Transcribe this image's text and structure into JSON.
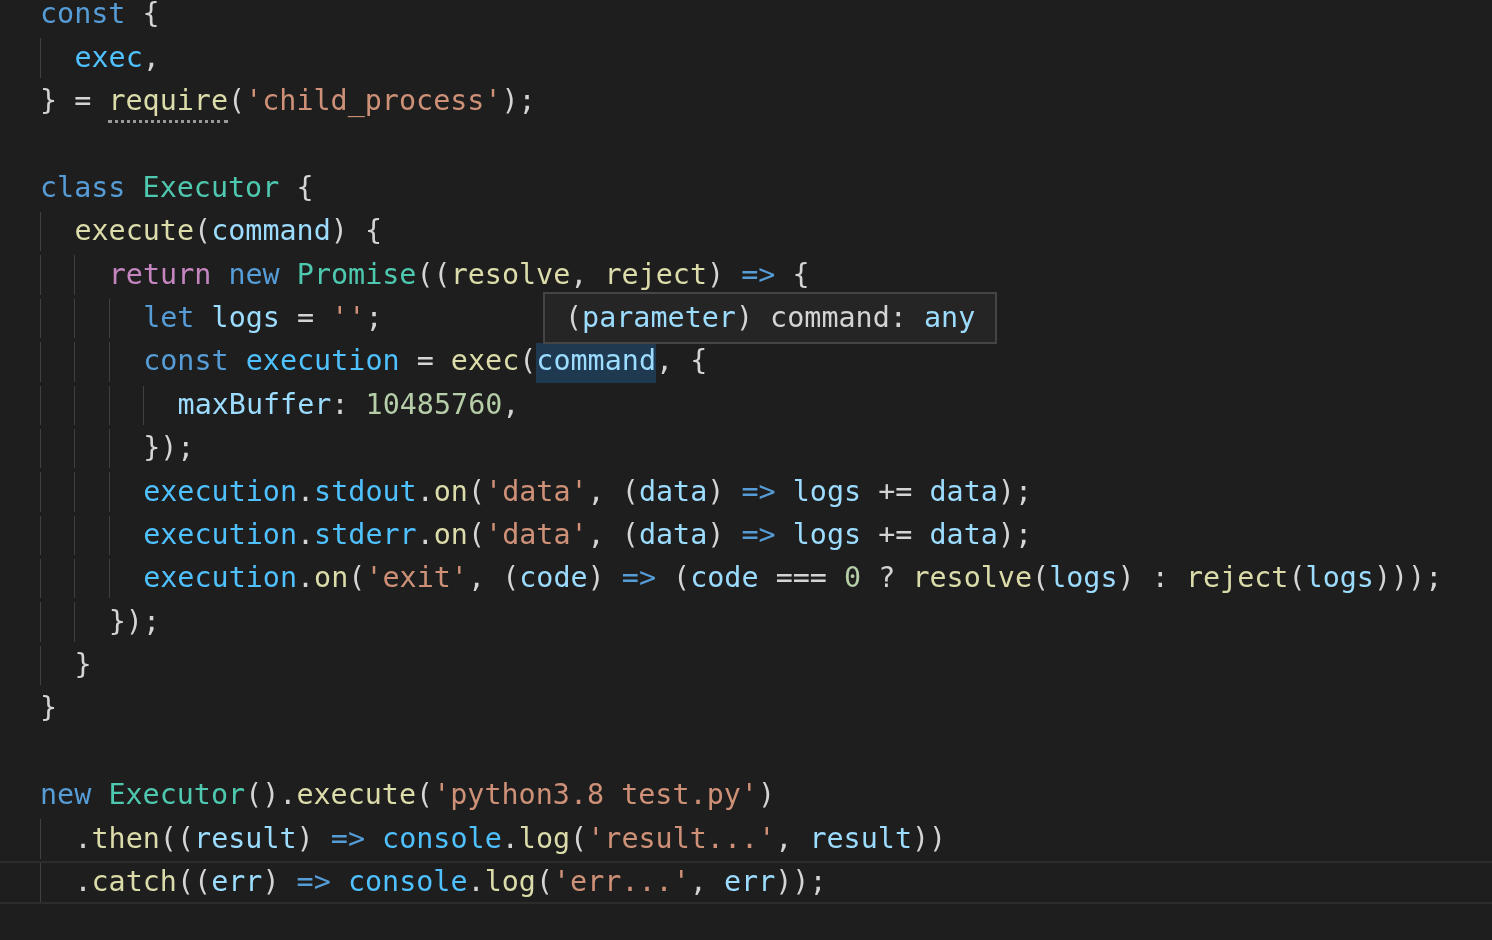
{
  "editor": {
    "lines": [
      {
        "kind": "code",
        "tokens": [
          {
            "t": "const ",
            "kind": "kw"
          },
          {
            "t": "{",
            "kind": "punc"
          }
        ],
        "children": [
          {
            "kind": "code",
            "tokens": [
              {
                "t": "exec",
                "kind": "cvar"
              },
              {
                "t": ",",
                "kind": "punc"
              }
            ]
          }
        ]
      },
      {
        "kind": "code",
        "tokens": [
          {
            "t": "} = ",
            "kind": "punc"
          },
          {
            "t": "require",
            "kind": "fn",
            "hint": true
          },
          {
            "t": "(",
            "kind": "punc"
          },
          {
            "t": "'child_process'",
            "kind": "str"
          },
          {
            "t": ");",
            "kind": "punc"
          }
        ]
      },
      {
        "kind": "blank"
      },
      {
        "kind": "code",
        "tokens": [
          {
            "t": "class ",
            "kind": "kw"
          },
          {
            "t": "Executor ",
            "kind": "cls"
          },
          {
            "t": "{",
            "kind": "punc"
          }
        ],
        "children": [
          {
            "kind": "code",
            "tokens": [
              {
                "t": "execute",
                "kind": "fn"
              },
              {
                "t": "(",
                "kind": "punc"
              },
              {
                "t": "command",
                "kind": "var"
              },
              {
                "t": ") {",
                "kind": "punc"
              }
            ],
            "children": [
              {
                "kind": "code",
                "tokens": [
                  {
                    "t": "return ",
                    "kind": "ctl"
                  },
                  {
                    "t": "new ",
                    "kind": "kw"
                  },
                  {
                    "t": "Promise",
                    "kind": "cls"
                  },
                  {
                    "t": "((",
                    "kind": "punc"
                  },
                  {
                    "t": "resolve",
                    "kind": "fn"
                  },
                  {
                    "t": ", ",
                    "kind": "punc"
                  },
                  {
                    "t": "reject",
                    "kind": "fn"
                  },
                  {
                    "t": ") ",
                    "kind": "punc"
                  },
                  {
                    "t": "=> ",
                    "kind": "kw"
                  },
                  {
                    "t": "{",
                    "kind": "punc"
                  }
                ],
                "children": [
                  {
                    "kind": "code",
                    "tokens": [
                      {
                        "t": "let ",
                        "kind": "kw"
                      },
                      {
                        "t": "logs",
                        "kind": "var"
                      },
                      {
                        "t": " = ",
                        "kind": "punc"
                      },
                      {
                        "t": "''",
                        "kind": "str"
                      },
                      {
                        "t": ";",
                        "kind": "punc"
                      }
                    ]
                  },
                  {
                    "kind": "code",
                    "tokens": [
                      {
                        "t": "const ",
                        "kind": "kw"
                      },
                      {
                        "t": "execution",
                        "kind": "cvar"
                      },
                      {
                        "t": " = ",
                        "kind": "punc"
                      },
                      {
                        "t": "exec",
                        "kind": "fn"
                      },
                      {
                        "t": "(",
                        "kind": "punc"
                      },
                      {
                        "t": "command",
                        "kind": "var",
                        "highlighted": true
                      },
                      {
                        "t": ", {",
                        "kind": "punc"
                      }
                    ],
                    "children": [
                      {
                        "kind": "code",
                        "tokens": [
                          {
                            "t": "maxBuffer",
                            "kind": "var"
                          },
                          {
                            "t": ": ",
                            "kind": "punc"
                          },
                          {
                            "t": "10485760",
                            "kind": "num"
                          },
                          {
                            "t": ",",
                            "kind": "punc"
                          }
                        ]
                      }
                    ]
                  },
                  {
                    "kind": "code",
                    "tokens": [
                      {
                        "t": "});",
                        "kind": "punc"
                      }
                    ]
                  },
                  {
                    "kind": "code",
                    "tokens": [
                      {
                        "t": "execution",
                        "kind": "cvar"
                      },
                      {
                        "t": ".",
                        "kind": "punc"
                      },
                      {
                        "t": "stdout",
                        "kind": "cvar"
                      },
                      {
                        "t": ".",
                        "kind": "punc"
                      },
                      {
                        "t": "on",
                        "kind": "fn"
                      },
                      {
                        "t": "(",
                        "kind": "punc"
                      },
                      {
                        "t": "'data'",
                        "kind": "str"
                      },
                      {
                        "t": ", (",
                        "kind": "punc"
                      },
                      {
                        "t": "data",
                        "kind": "var"
                      },
                      {
                        "t": ") ",
                        "kind": "punc"
                      },
                      {
                        "t": "=> ",
                        "kind": "kw"
                      },
                      {
                        "t": "logs",
                        "kind": "var"
                      },
                      {
                        "t": " += ",
                        "kind": "punc"
                      },
                      {
                        "t": "data",
                        "kind": "var"
                      },
                      {
                        "t": ");",
                        "kind": "punc"
                      }
                    ]
                  },
                  {
                    "kind": "code",
                    "tokens": [
                      {
                        "t": "execution",
                        "kind": "cvar"
                      },
                      {
                        "t": ".",
                        "kind": "punc"
                      },
                      {
                        "t": "stderr",
                        "kind": "cvar"
                      },
                      {
                        "t": ".",
                        "kind": "punc"
                      },
                      {
                        "t": "on",
                        "kind": "fn"
                      },
                      {
                        "t": "(",
                        "kind": "punc"
                      },
                      {
                        "t": "'data'",
                        "kind": "str"
                      },
                      {
                        "t": ", (",
                        "kind": "punc"
                      },
                      {
                        "t": "data",
                        "kind": "var"
                      },
                      {
                        "t": ") ",
                        "kind": "punc"
                      },
                      {
                        "t": "=> ",
                        "kind": "kw"
                      },
                      {
                        "t": "logs",
                        "kind": "var"
                      },
                      {
                        "t": " += ",
                        "kind": "punc"
                      },
                      {
                        "t": "data",
                        "kind": "var"
                      },
                      {
                        "t": ");",
                        "kind": "punc"
                      }
                    ]
                  },
                  {
                    "kind": "code",
                    "tokens": [
                      {
                        "t": "execution",
                        "kind": "cvar"
                      },
                      {
                        "t": ".",
                        "kind": "punc"
                      },
                      {
                        "t": "on",
                        "kind": "fn"
                      },
                      {
                        "t": "(",
                        "kind": "punc"
                      },
                      {
                        "t": "'exit'",
                        "kind": "str"
                      },
                      {
                        "t": ", (",
                        "kind": "punc"
                      },
                      {
                        "t": "code",
                        "kind": "var"
                      },
                      {
                        "t": ") ",
                        "kind": "punc"
                      },
                      {
                        "t": "=> ",
                        "kind": "kw"
                      },
                      {
                        "t": "(",
                        "kind": "punc"
                      },
                      {
                        "t": "code",
                        "kind": "var"
                      },
                      {
                        "t": " === ",
                        "kind": "punc"
                      },
                      {
                        "t": "0",
                        "kind": "num"
                      },
                      {
                        "t": " ? ",
                        "kind": "punc"
                      },
                      {
                        "t": "resolve",
                        "kind": "fn"
                      },
                      {
                        "t": "(",
                        "kind": "punc"
                      },
                      {
                        "t": "logs",
                        "kind": "var"
                      },
                      {
                        "t": ") : ",
                        "kind": "punc"
                      },
                      {
                        "t": "reject",
                        "kind": "fn"
                      },
                      {
                        "t": "(",
                        "kind": "punc"
                      },
                      {
                        "t": "logs",
                        "kind": "var"
                      },
                      {
                        "t": ")));",
                        "kind": "punc"
                      }
                    ]
                  }
                ]
              },
              {
                "kind": "code",
                "tokens": [
                  {
                    "t": "});",
                    "kind": "punc"
                  }
                ]
              }
            ]
          },
          {
            "kind": "code",
            "tokens": [
              {
                "t": "}",
                "kind": "punc"
              }
            ]
          }
        ]
      },
      {
        "kind": "code",
        "tokens": [
          {
            "t": "}",
            "kind": "punc"
          }
        ]
      },
      {
        "kind": "blank"
      },
      {
        "kind": "code",
        "tokens": [
          {
            "t": "new ",
            "kind": "kw"
          },
          {
            "t": "Executor",
            "kind": "cls"
          },
          {
            "t": "().",
            "kind": "punc"
          },
          {
            "t": "execute",
            "kind": "fn"
          },
          {
            "t": "(",
            "kind": "punc"
          },
          {
            "t": "'python3.8 test.py'",
            "kind": "str"
          },
          {
            "t": ")",
            "kind": "punc"
          }
        ],
        "children": [
          {
            "kind": "code",
            "tokens": [
              {
                "t": ".",
                "kind": "punc"
              },
              {
                "t": "then",
                "kind": "fn"
              },
              {
                "t": "((",
                "kind": "punc"
              },
              {
                "t": "result",
                "kind": "var"
              },
              {
                "t": ") ",
                "kind": "punc"
              },
              {
                "t": "=> ",
                "kind": "kw"
              },
              {
                "t": "console",
                "kind": "cvar"
              },
              {
                "t": ".",
                "kind": "punc"
              },
              {
                "t": "log",
                "kind": "fn"
              },
              {
                "t": "(",
                "kind": "punc"
              },
              {
                "t": "'result...'",
                "kind": "str"
              },
              {
                "t": ", ",
                "kind": "punc"
              },
              {
                "t": "result",
                "kind": "var"
              },
              {
                "t": "))",
                "kind": "punc"
              }
            ]
          },
          {
            "kind": "code",
            "current": true,
            "tokens": [
              {
                "t": ".",
                "kind": "punc"
              },
              {
                "t": "catch",
                "kind": "fn"
              },
              {
                "t": "((",
                "kind": "punc"
              },
              {
                "t": "err",
                "kind": "var"
              },
              {
                "t": ") ",
                "kind": "punc"
              },
              {
                "t": "=> ",
                "kind": "kw"
              },
              {
                "t": "console",
                "kind": "cvar"
              },
              {
                "t": ".",
                "kind": "punc"
              },
              {
                "t": "log",
                "kind": "fn"
              },
              {
                "t": "(",
                "kind": "punc"
              },
              {
                "t": "'err...'",
                "kind": "str"
              },
              {
                "t": ", ",
                "kind": "punc"
              },
              {
                "t": "err",
                "kind": "var"
              },
              {
                "t": "));",
                "kind": "punc"
              }
            ]
          }
        ]
      }
    ],
    "tooltip": {
      "parts": [
        {
          "t": "(",
          "kind": "punc"
        },
        {
          "t": "parameter",
          "kind": "var"
        },
        {
          "t": ") command: ",
          "kind": "punc"
        },
        {
          "t": "any",
          "kind": "var"
        }
      ]
    }
  }
}
